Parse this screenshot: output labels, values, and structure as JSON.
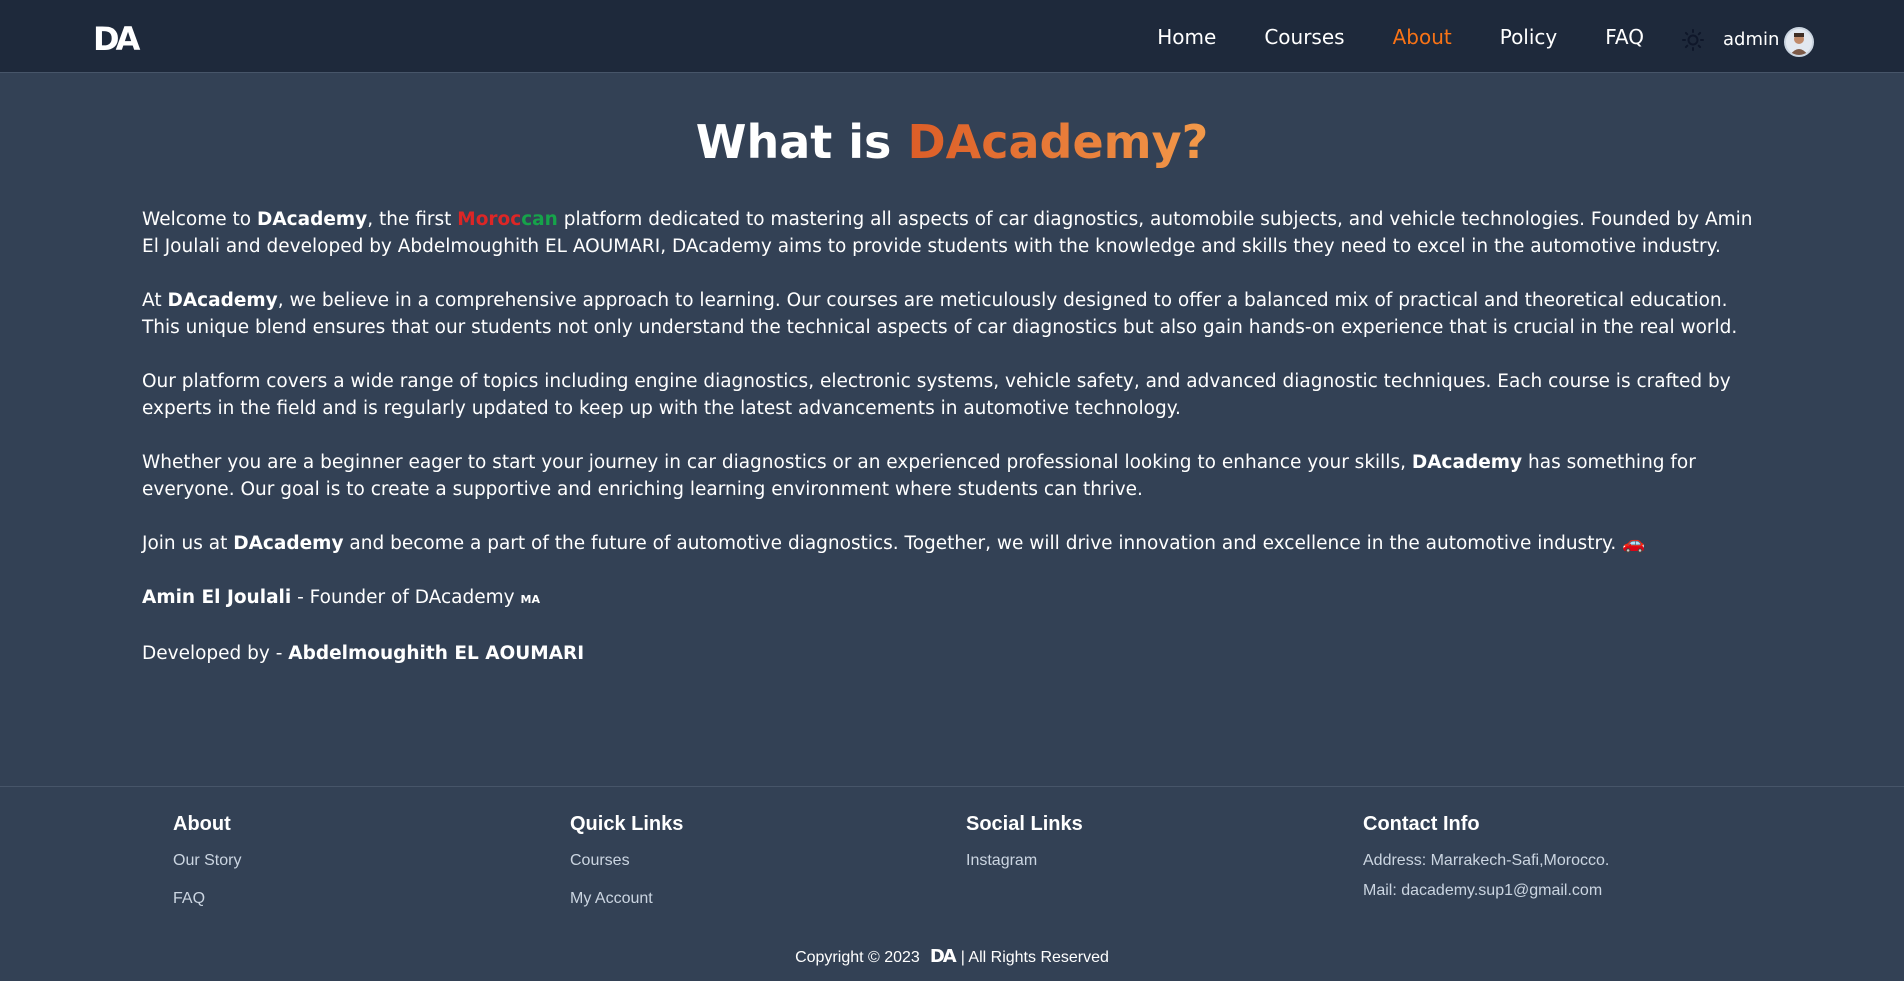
{
  "nav": {
    "logo": "DA",
    "links": [
      "Home",
      "Courses",
      "About",
      "Policy",
      "FAQ"
    ],
    "active": "About",
    "user": "admin",
    "colors": {
      "bar": "#1e293b",
      "accent": "#f97316"
    }
  },
  "hero": {
    "title_prefix": "What is",
    "title_brand": "DAcademy?"
  },
  "about": {
    "p1": {
      "t1": "Welcome to ",
      "brand": "DAcademy",
      "t2": ", the first ",
      "moroccan_red": "Moroc",
      "moroccan_green": "can",
      "t3": " platform dedicated to mastering all aspects of car diagnostics, automobile subjects, and vehicle technologies. Founded by Amin El Joulali and developed by Abdelmoughith EL AOUMARI, DAcademy aims to provide students with the knowledge and skills they need to excel in the automotive industry."
    },
    "p2": {
      "t1": "At ",
      "brand": "DAcademy",
      "t2": ", we believe in a comprehensive approach to learning. Our courses are meticulously designed to offer a balanced mix of practical and theoretical education. This unique blend ensures that our students not only understand the technical aspects of car diagnostics but also gain hands-on experience that is crucial in the real world."
    },
    "p3": "Our platform covers a wide range of topics including engine diagnostics, electronic systems, vehicle safety, and advanced diagnostic techniques. Each course is crafted by experts in the field and is regularly updated to keep up with the latest advancements in automotive technology.",
    "p4": {
      "t1": "Whether you are a beginner eager to start your journey in car diagnostics or an experienced professional looking to enhance your skills, ",
      "brand": "DAcademy",
      "t2": " has something for everyone. Our goal is to create a supportive and enriching learning environment where students can thrive."
    },
    "p5": {
      "t1": "Join us at ",
      "brand": "DAcademy",
      "t2": " and become a part of the future of automotive diagnostics. Together, we will drive innovation and excellence in the automotive industry. ",
      "car": "🚗"
    },
    "founder": {
      "name": "Amin El Joulali",
      "rest": " - Founder of DAcademy ",
      "flag": "MA"
    },
    "developer": {
      "label": "Developed by - ",
      "name": "Abdelmoughith EL AOUMARI"
    }
  },
  "footer": {
    "about": {
      "title": "About",
      "links": [
        "Our Story",
        "FAQ"
      ]
    },
    "quick": {
      "title": "Quick Links",
      "links": [
        "Courses",
        "My Account"
      ]
    },
    "social": {
      "title": "Social Links",
      "links": [
        "Instagram"
      ]
    },
    "contact": {
      "title": "Contact Info",
      "address": "Address: Marrakech-Safi,Morocco.",
      "mail": "Mail: dacademy.sup1@gmail.com"
    },
    "copyright_left": "Copyright © 2023",
    "logo": "DA",
    "copyright_right": "| All Rights Reserved"
  }
}
